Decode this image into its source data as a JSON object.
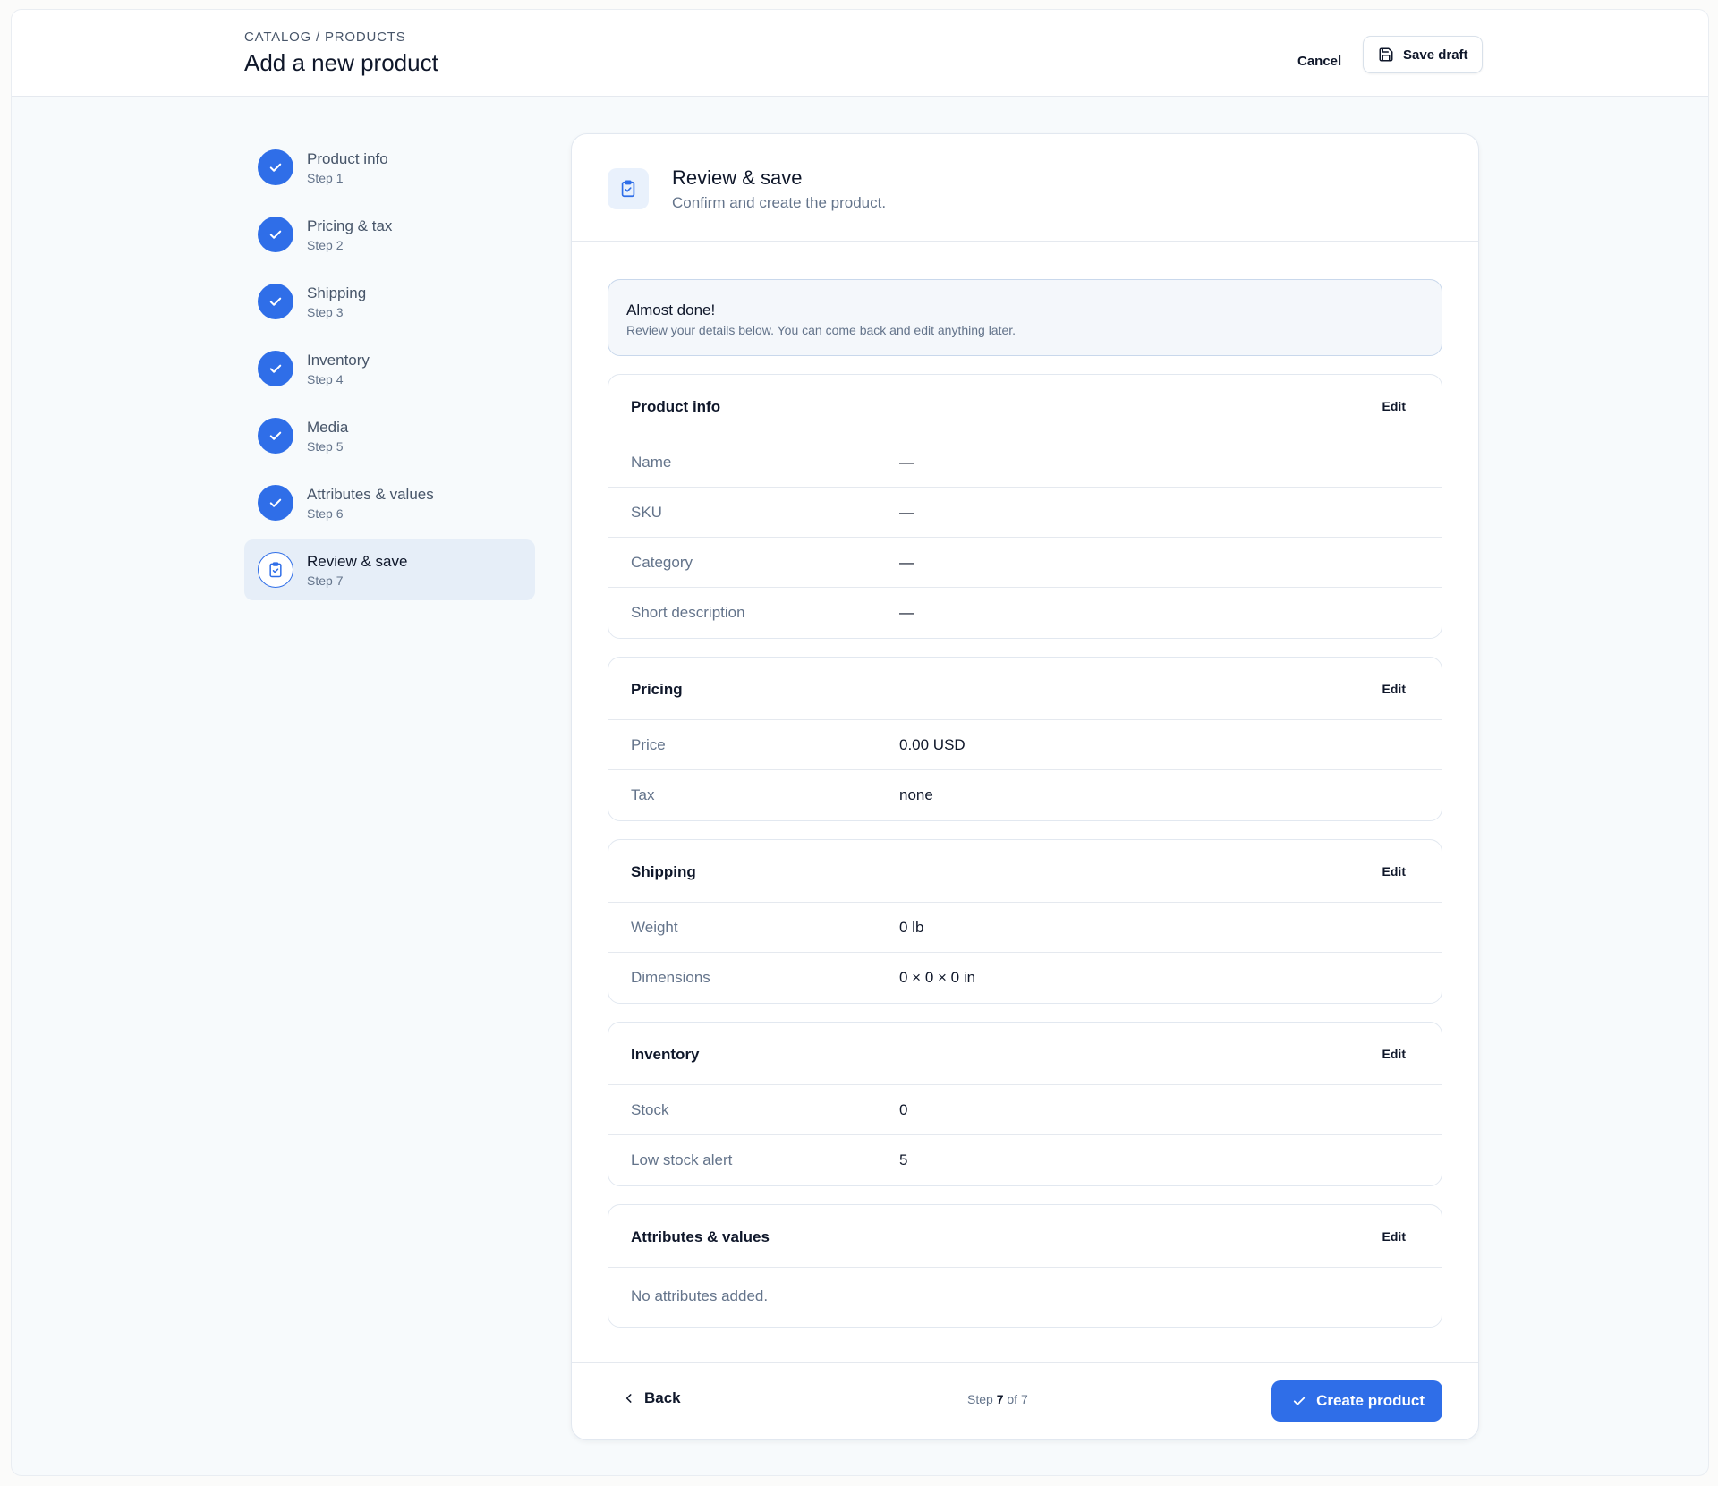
{
  "header": {
    "breadcrumb": "CATALOG / PRODUCTS",
    "title": "Add a new product",
    "cancel_label": "Cancel",
    "save_draft_label": "Save draft"
  },
  "steps": [
    {
      "label": "Product info",
      "sub": "Step 1",
      "status": "complete"
    },
    {
      "label": "Pricing & tax",
      "sub": "Step 2",
      "status": "complete"
    },
    {
      "label": "Shipping",
      "sub": "Step 3",
      "status": "complete"
    },
    {
      "label": "Inventory",
      "sub": "Step 4",
      "status": "complete"
    },
    {
      "label": "Media",
      "sub": "Step 5",
      "status": "complete"
    },
    {
      "label": "Attributes & values",
      "sub": "Step 6",
      "status": "complete"
    },
    {
      "label": "Review & save",
      "sub": "Step 7",
      "status": "active"
    }
  ],
  "card": {
    "title": "Review & save",
    "subtitle": "Confirm and create the product.",
    "notice_title": "Almost done!",
    "notice_text": "Review your details below. You can come back and edit anything later.",
    "edit_label": "Edit"
  },
  "sections": {
    "product_info": {
      "title": "Product info",
      "rows": [
        {
          "key": "Name",
          "value": "—"
        },
        {
          "key": "SKU",
          "value": "—"
        },
        {
          "key": "Category",
          "value": "—"
        },
        {
          "key": "Short description",
          "value": "—"
        }
      ]
    },
    "pricing": {
      "title": "Pricing",
      "rows": [
        {
          "key": "Price",
          "value": "0.00 USD"
        },
        {
          "key": "Tax",
          "value": "none"
        }
      ]
    },
    "shipping": {
      "title": "Shipping",
      "rows": [
        {
          "key": "Weight",
          "value": "0 lb"
        },
        {
          "key": "Dimensions",
          "value": "0 × 0 × 0 in"
        }
      ]
    },
    "inventory": {
      "title": "Inventory",
      "rows": [
        {
          "key": "Stock",
          "value": "0"
        },
        {
          "key": "Low stock alert",
          "value": "5"
        }
      ]
    },
    "attributes": {
      "title": "Attributes & values",
      "empty_text": "No attributes added."
    }
  },
  "footer": {
    "back_label": "Back",
    "step_prefix": "Step",
    "step_current": "7",
    "step_suffix": "of 7",
    "create_label": "Create product"
  },
  "colors": {
    "accent": "#2f6ee8",
    "active_step_bg": "#e6eef8"
  },
  "icons": {
    "step_complete": "check-icon",
    "step_active": "clipboard-check-icon",
    "save_draft": "floppy-disk-icon",
    "back": "chevron-left-icon",
    "create": "check-icon"
  }
}
